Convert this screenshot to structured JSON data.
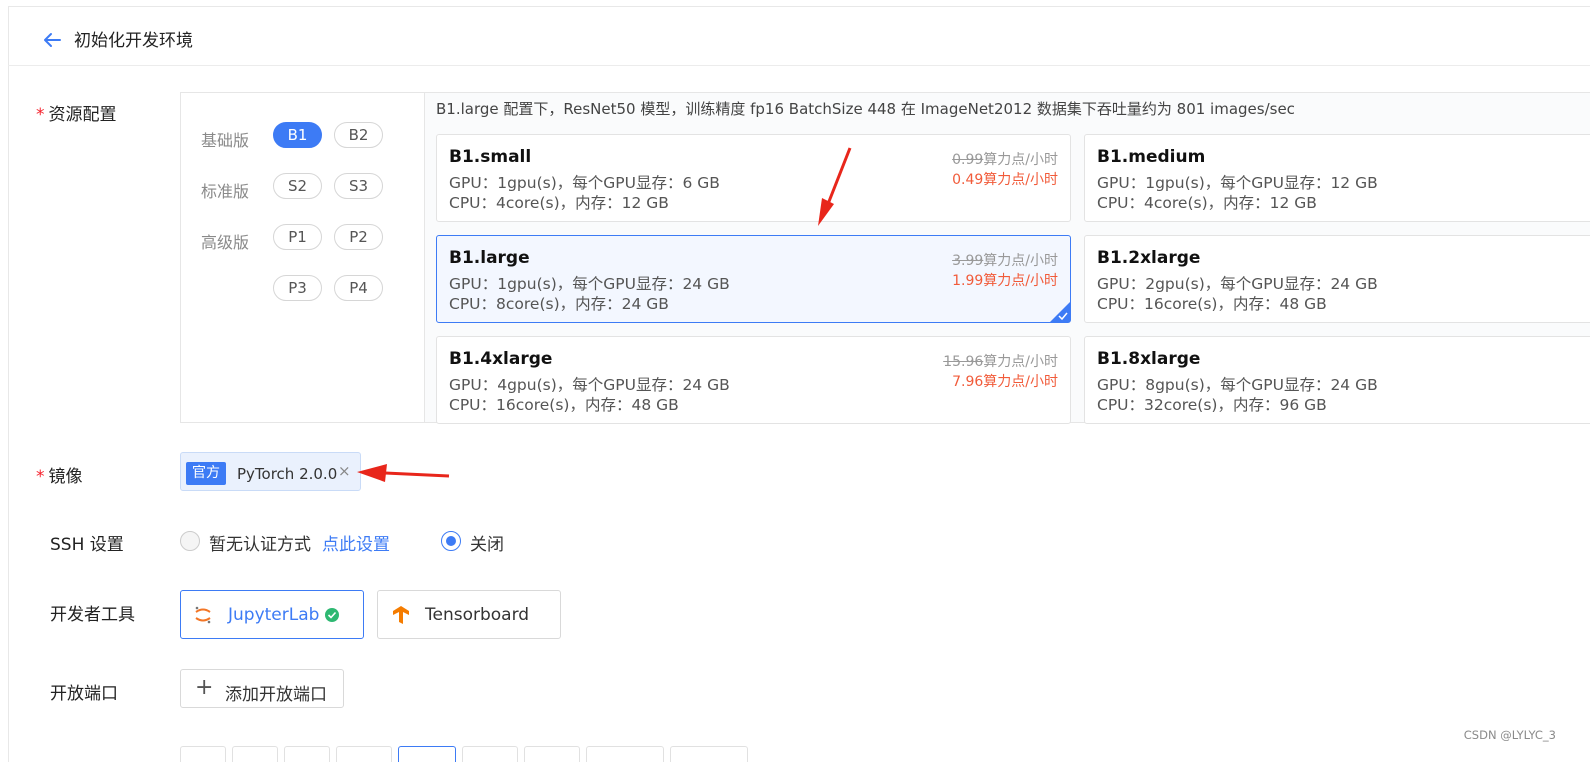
{
  "header": {
    "title": "初始化开发环境"
  },
  "resource": {
    "label": "资源配置",
    "required_mark": "*",
    "tiers": [
      {
        "label": "基础版",
        "options": [
          "B1",
          "B2"
        ]
      },
      {
        "label": "标准版",
        "options": [
          "S2",
          "S3"
        ]
      },
      {
        "label": "高级版",
        "options": [
          "P1",
          "P2",
          "P3",
          "P4"
        ]
      }
    ],
    "selected_option": "B1",
    "perf_note": "B1.large 配置下，ResNet50 模型，训练精度 fp16 BatchSize 448 在 ImageNet2012 数据集下吞吐量约为 801 images/sec",
    "specs": [
      {
        "name": "B1.small",
        "gpu": "GPU：1gpu(s)，每个GPU显存：6 GB",
        "cpu": "CPU：4core(s)，内存：12 GB",
        "old_price": "0.99",
        "new_price": "0.49算力点/小时",
        "price_unit": "算力点/小时"
      },
      {
        "name": "B1.medium",
        "gpu": "GPU：1gpu(s)，每个GPU显存：12 GB",
        "cpu": "CPU：4core(s)，内存：12 GB"
      },
      {
        "name": "B1.large",
        "gpu": "GPU：1gpu(s)，每个GPU显存：24 GB",
        "cpu": "CPU：8core(s)，内存：24 GB",
        "old_price": "3.99",
        "new_price": "1.99算力点/小时",
        "price_unit": "算力点/小时",
        "selected": true
      },
      {
        "name": "B1.2xlarge",
        "gpu": "GPU：2gpu(s)，每个GPU显存：24 GB",
        "cpu": "CPU：16core(s)，内存：48 GB"
      },
      {
        "name": "B1.4xlarge",
        "gpu": "GPU：4gpu(s)，每个GPU显存：24 GB",
        "cpu": "CPU：16core(s)，内存：48 GB",
        "old_price": "15.96",
        "new_price": "7.96算力点/小时",
        "price_unit": "算力点/小时"
      },
      {
        "name": "B1.8xlarge",
        "gpu": "GPU：8gpu(s)，每个GPU显存：24 GB",
        "cpu": "CPU：32core(s)，内存：96 GB"
      }
    ]
  },
  "image": {
    "label": "镜像",
    "required_mark": "*",
    "tag": "官方",
    "name": "PyTorch 2.0.0",
    "remove": "×"
  },
  "ssh": {
    "label": "SSH 设置",
    "option1": "暂无认证方式",
    "option1_link": "点此设置",
    "option2": "关闭",
    "selected": "关闭"
  },
  "devtools": {
    "label": "开发者工具",
    "tools": [
      "JupyterLab",
      "Tensorboard"
    ],
    "selected": "JupyterLab"
  },
  "ports": {
    "label": "开放端口",
    "add_button": "添加开放端口"
  },
  "watermark": "CSDN @LYLYC_3",
  "colors": {
    "accent": "#3d7bf5",
    "price_red": "#f15b3a",
    "required_red": "#f5222d",
    "arrow_red": "#e8261b"
  }
}
